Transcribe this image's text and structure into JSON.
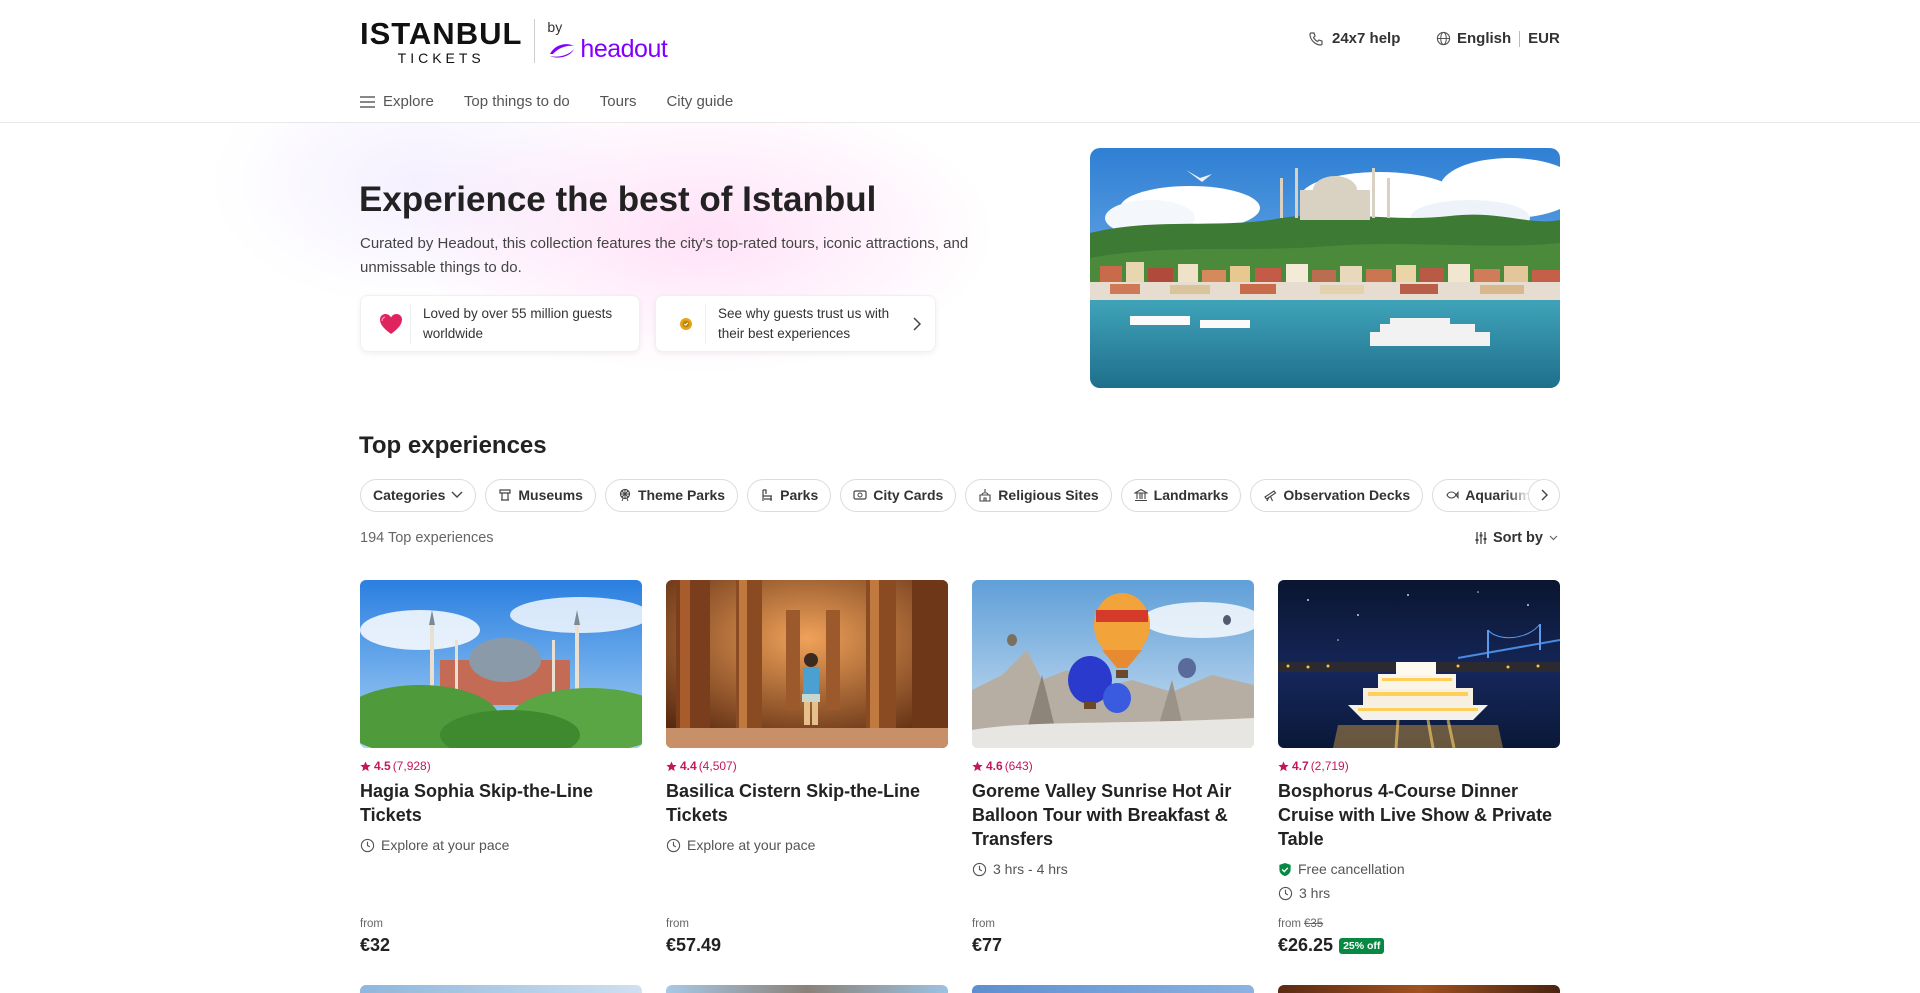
{
  "header": {
    "logo_line1": "ISTANBUL",
    "logo_line2": "TICKETS",
    "logo_by": "by",
    "logo_brand": "headout",
    "help_label": "24x7 help",
    "language": "English",
    "currency": "EUR"
  },
  "nav": {
    "explore": "Explore",
    "items": [
      "Top things to do",
      "Tours",
      "City guide"
    ]
  },
  "hero": {
    "title": "Experience the best of Istanbul",
    "description": "Curated by Headout, this collection features the city's top-rated tours, iconic attractions, and unmissable things to do.",
    "trust1": "Loved by over 55 million guests worldwide",
    "trust2": "See why guests trust us with their best experiences"
  },
  "experiences": {
    "title": "Top experiences",
    "chips": [
      "Categories",
      "Museums",
      "Theme Parks",
      "Parks",
      "City Cards",
      "Religious Sites",
      "Landmarks",
      "Observation Decks",
      "Aquariums"
    ],
    "count_label": "194 Top experiences",
    "sort_label": "Sort by",
    "cards": [
      {
        "rating": "4.5",
        "reviews": "(7,928)",
        "name": "Hagia Sophia Skip-the-Line Tickets",
        "meta": [
          "Explore at your pace"
        ],
        "from": "from",
        "original_price": "",
        "price": "€32",
        "discount": ""
      },
      {
        "rating": "4.4",
        "reviews": "(4,507)",
        "name": "Basilica Cistern Skip-the-Line Tickets",
        "meta": [
          "Explore at your pace"
        ],
        "from": "from",
        "original_price": "",
        "price": "€57.49",
        "discount": ""
      },
      {
        "rating": "4.6",
        "reviews": "(643)",
        "name": "Goreme Valley Sunrise Hot Air Balloon Tour with Breakfast & Transfers",
        "meta": [
          "3 hrs - 4 hrs"
        ],
        "from": "from",
        "original_price": "",
        "price": "€77",
        "discount": ""
      },
      {
        "rating": "4.7",
        "reviews": "(2,719)",
        "name": "Bosphorus 4-Course Dinner Cruise with Live Show & Private Table",
        "meta": [
          "Free cancellation",
          "3 hrs"
        ],
        "from": "from",
        "original_price": "€35",
        "price": "€26.25",
        "discount": "25% off"
      }
    ]
  },
  "colors": {
    "brand": "#8000ff",
    "rating": "#c2185b",
    "discount": "#088943"
  }
}
